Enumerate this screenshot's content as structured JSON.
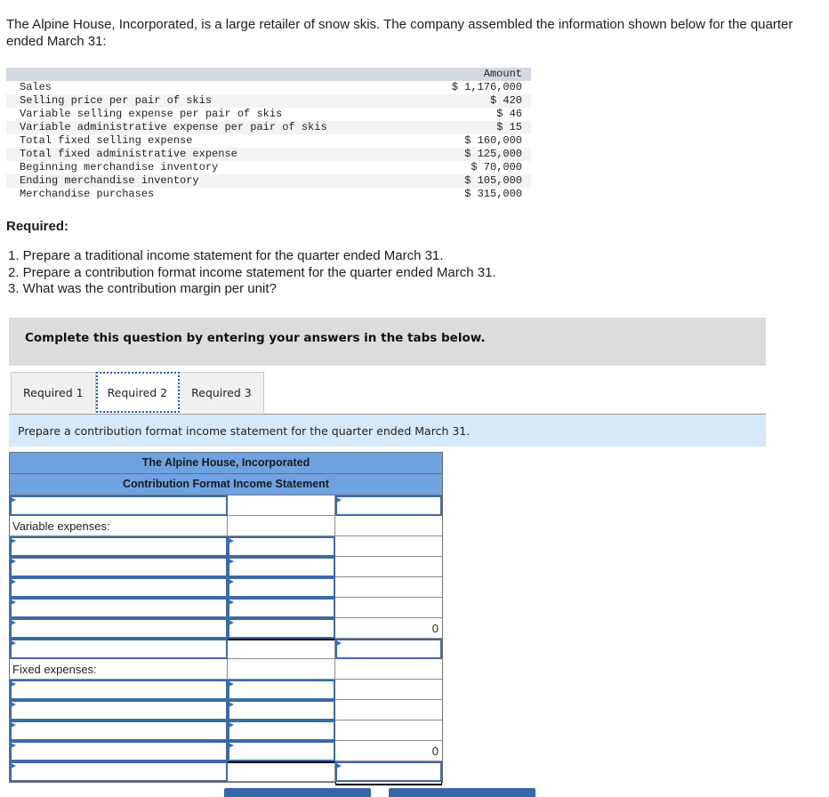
{
  "intro": "The Alpine House, Incorporated, is a large retailer of snow skis. The company assembled the information shown below for the quarter ended March 31:",
  "given": {
    "header_amount": "Amount",
    "rows": [
      {
        "label": "Sales",
        "amount": "$ 1,176,000"
      },
      {
        "label": "Selling price per pair of skis",
        "amount": "$ 420"
      },
      {
        "label": "Variable selling expense per pair of skis",
        "amount": "$ 46"
      },
      {
        "label": "Variable administrative expense per pair of skis",
        "amount": "$ 15"
      },
      {
        "label": "Total fixed selling expense",
        "amount": "$ 160,000"
      },
      {
        "label": "Total fixed administrative expense",
        "amount": "$ 125,000"
      },
      {
        "label": "Beginning merchandise inventory",
        "amount": "$ 70,000"
      },
      {
        "label": "Ending merchandise inventory",
        "amount": "$ 105,000"
      },
      {
        "label": "Merchandise purchases",
        "amount": "$ 315,000"
      }
    ]
  },
  "required": {
    "heading": "Required:",
    "items": [
      "1. Prepare a traditional income statement for the quarter ended March 31.",
      "2. Prepare a contribution format income statement for the quarter ended March 31.",
      "3. What was the contribution margin per unit?"
    ]
  },
  "banner": "Complete this question by entering your answers in the tabs below.",
  "tabs": [
    {
      "label": "Required 1",
      "active": false
    },
    {
      "label": "Required 2",
      "active": true
    },
    {
      "label": "Required 3",
      "active": false
    }
  ],
  "instruction": "Prepare a contribution format income statement for the quarter ended March 31.",
  "statement": {
    "company": "The Alpine House, Incorporated",
    "title": "Contribution Format Income Statement",
    "variable_label": "Variable expenses:",
    "fixed_label": "Fixed expenses:",
    "variable_total": "0",
    "fixed_total": "0"
  }
}
